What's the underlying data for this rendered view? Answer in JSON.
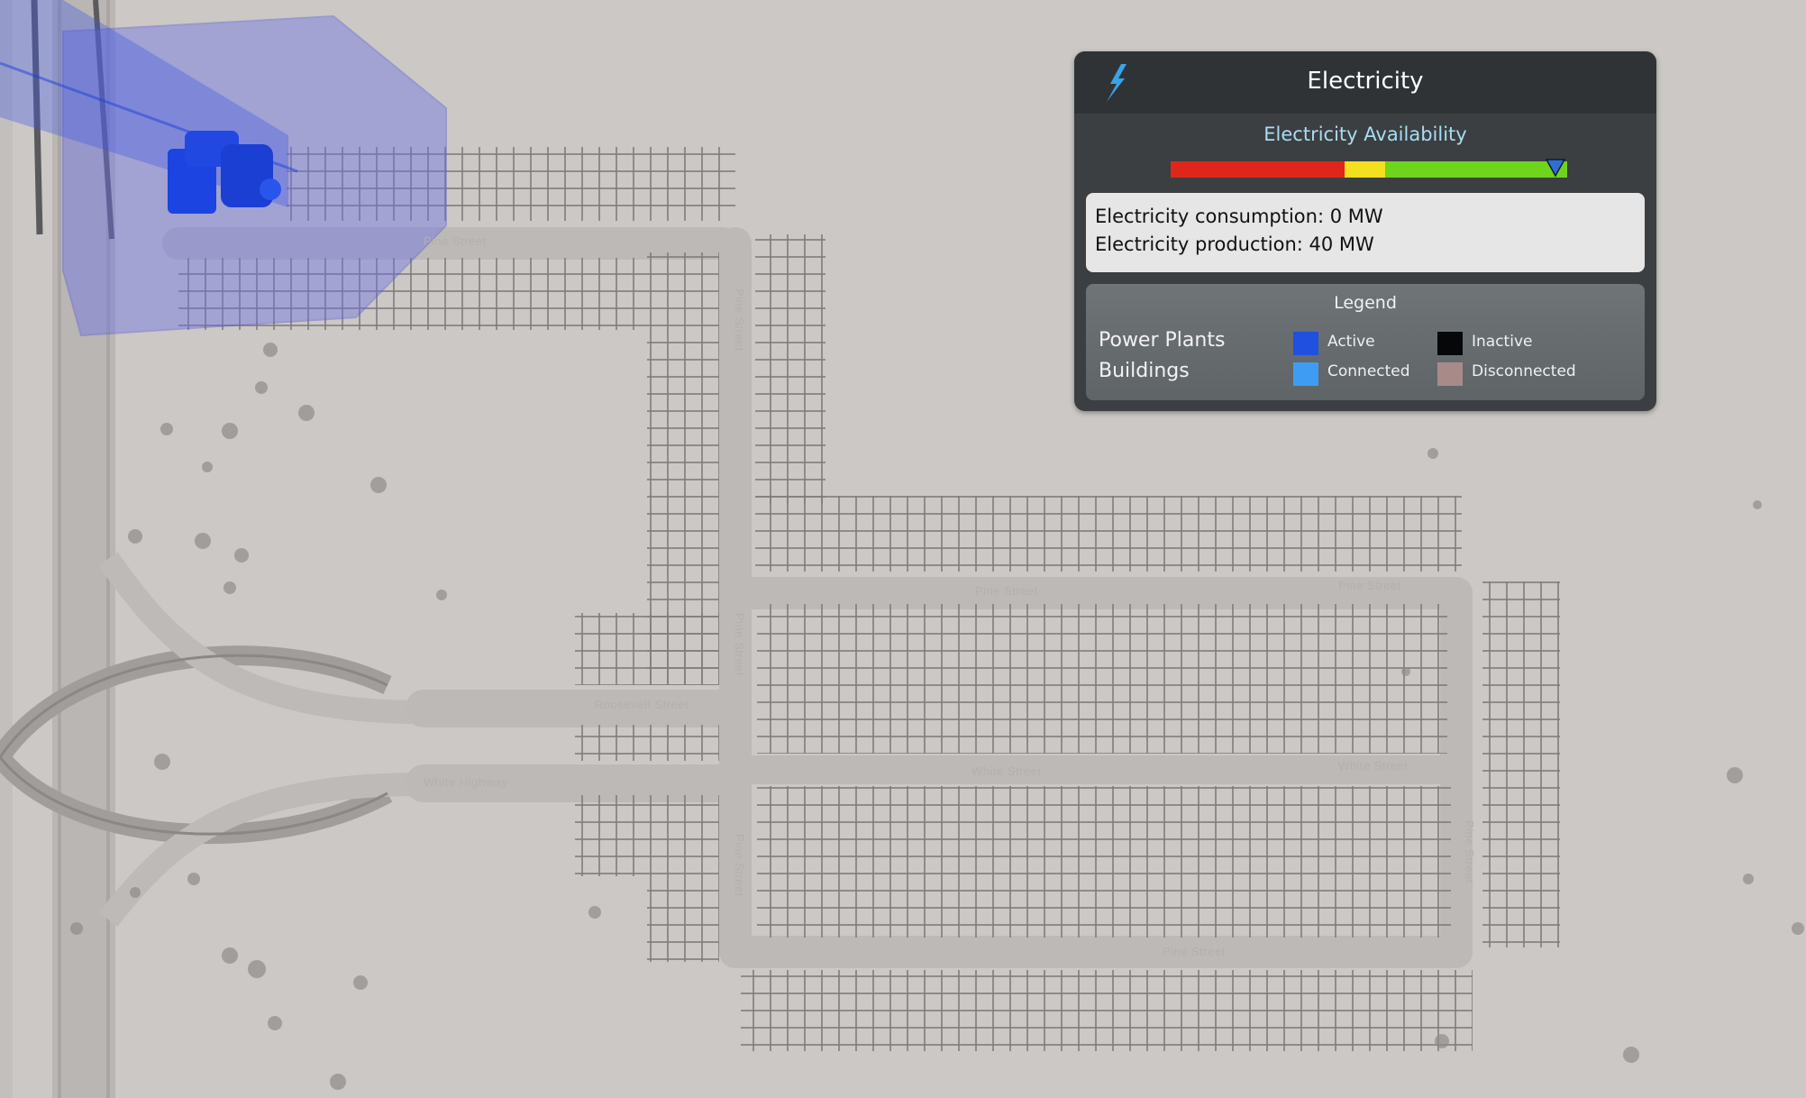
{
  "map": {
    "street_labels": [
      "Pine Street",
      "Pine Street",
      "Pine Street",
      "Pine Street",
      "Pine Street",
      "Pine Street",
      "Pine Street",
      "Roosevelt Street",
      "White Highway",
      "White Street",
      "White Street",
      "Pine Street"
    ]
  },
  "panel": {
    "icon": "lightning-bolt-icon",
    "title": "Electricity",
    "availability_label": "Electricity Availability",
    "availability_level": 0.97,
    "availability_bar_colors": [
      "#e0261b",
      "#f3e01e",
      "#6fd41c"
    ],
    "consumption_text": "Electricity consumption: 0 MW",
    "production_text": "Electricity production: 40 MW",
    "legend": {
      "title": "Legend",
      "rows": [
        "Power Plants",
        "Buildings"
      ],
      "items": [
        {
          "label": "Active",
          "color": "#2050e0"
        },
        {
          "label": "Inactive",
          "color": "#050708"
        },
        {
          "label": "Connected",
          "color": "#3e9df2"
        },
        {
          "label": "Disconnected",
          "color": "#a88b89"
        }
      ]
    }
  }
}
